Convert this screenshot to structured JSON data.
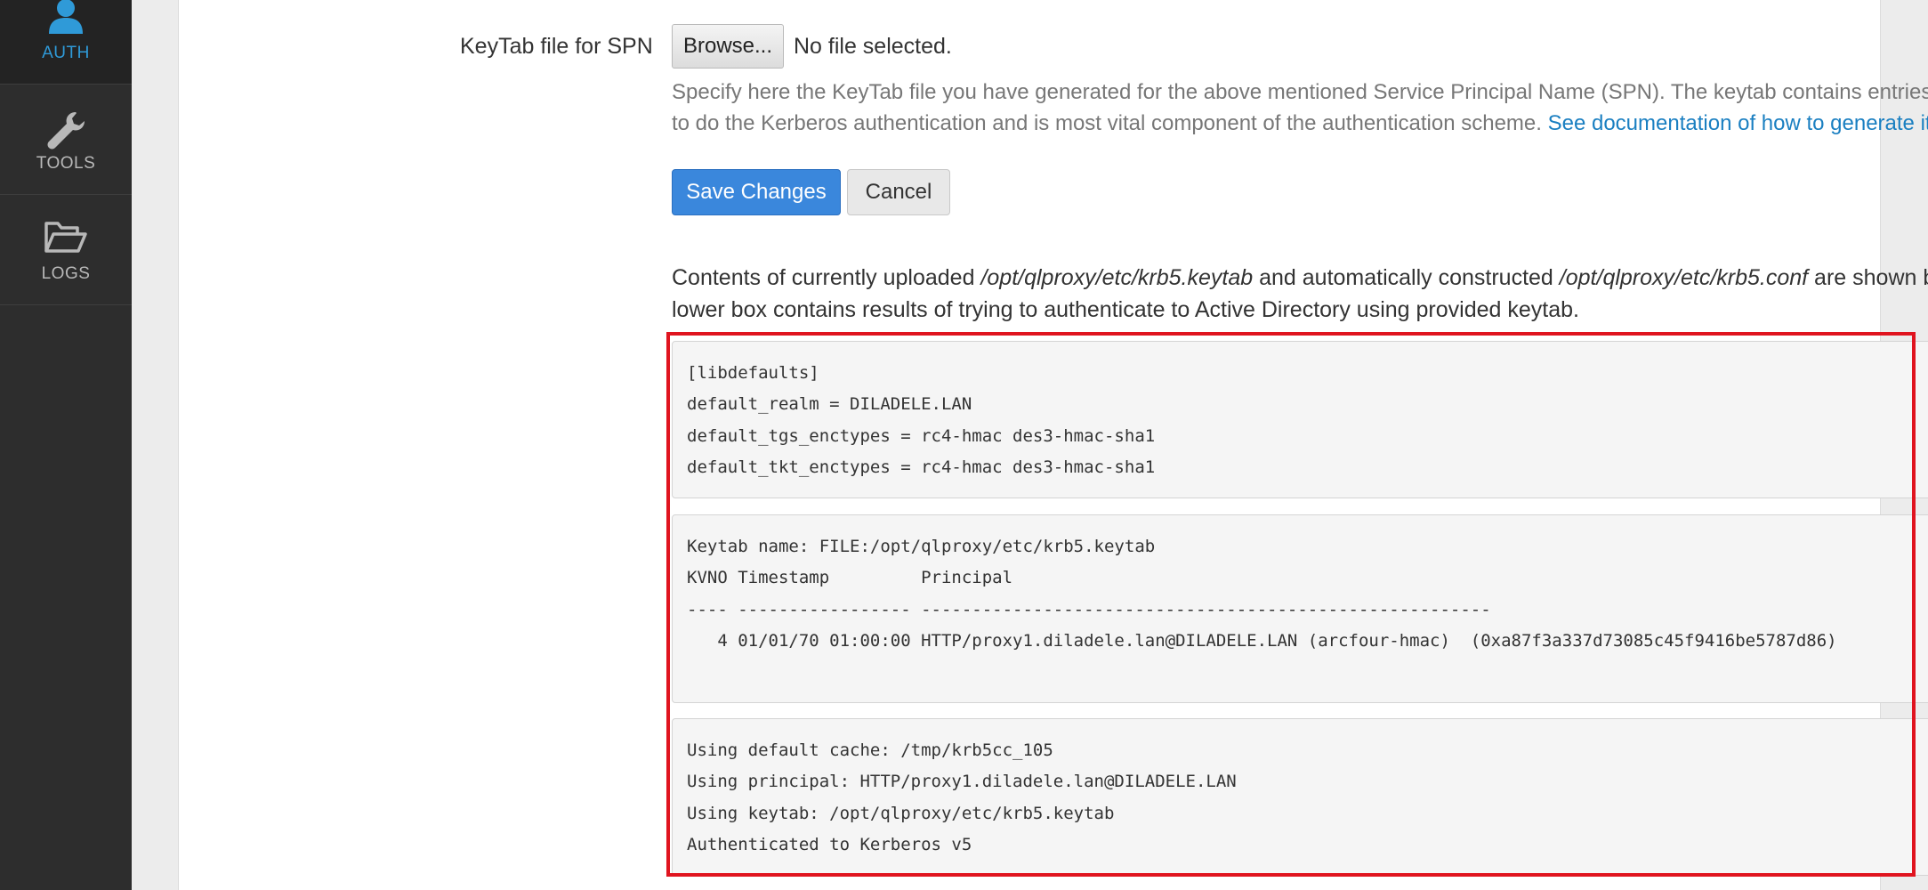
{
  "sidebar": {
    "items": [
      {
        "label": "AUTH",
        "icon": "user-icon",
        "active": true
      },
      {
        "label": "TOOLS",
        "icon": "wrench-icon",
        "active": false
      },
      {
        "label": "LOGS",
        "icon": "folder-open-icon",
        "active": false
      }
    ]
  },
  "form": {
    "keytab_label": "KeyTab file for SPN",
    "browse_label": "Browse...",
    "file_status": "No file selected.",
    "help_text": "Specify here the KeyTab file you have generated for the above mentioned Service Principal Name (SPN). The keytab contains entries required to do the Kerberos authentication and is most vital component of the authentication scheme. ",
    "help_link": "See documentation of how to generate it.",
    "save_label": "Save Changes",
    "cancel_label": "Cancel"
  },
  "info": {
    "part1": "Contents of currently uploaded ",
    "keytab_path": "/opt/qlproxy/etc/krb5.keytab",
    "part2": " and automatically constructed ",
    "conf_path": "/opt/qlproxy/etc/krb5.conf",
    "part3": " are shown below. The lower box contains results of trying to authenticate to Active Directory using provided keytab."
  },
  "krb5_conf": [
    "[libdefaults]",
    "default_realm = DILADELE.LAN",
    "default_tgs_enctypes = rc4-hmac des3-hmac-sha1",
    "default_tkt_enctypes = rc4-hmac des3-hmac-sha1"
  ],
  "keytab_list": [
    "Keytab name: FILE:/opt/qlproxy/etc/krb5.keytab",
    "KVNO Timestamp         Principal",
    "---- ----------------- --------------------------------------------------------",
    "   4 01/01/70 01:00:00 HTTP/proxy1.diladele.lan@DILADELE.LAN (arcfour-hmac)  (0xa87f3a337d73085c45f9416be5787d86)"
  ],
  "auth_result": [
    "Using default cache: /tmp/krb5cc_105",
    "Using principal: HTTP/proxy1.diladele.lan@DILADELE.LAN",
    "Using keytab: /opt/qlproxy/etc/krb5.keytab",
    "Authenticated to Kerberos v5"
  ],
  "colors": {
    "accent": "#2f9ad8",
    "primary_button": "#3a87dc",
    "link": "#1a7fc1",
    "highlight": "#e0141f",
    "sidebar_bg": "#2d2d2d"
  }
}
